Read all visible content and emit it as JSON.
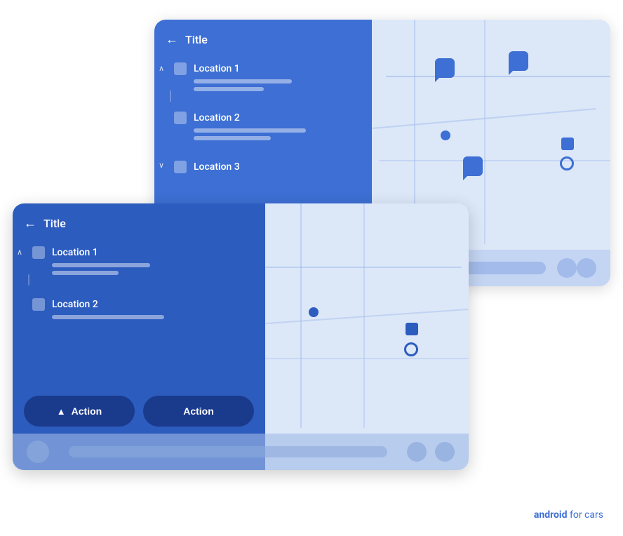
{
  "back_card": {
    "title": "Title",
    "back_arrow": "←",
    "locations": [
      {
        "name": "Location 1",
        "sub_lines": [
          140,
          100
        ],
        "expanded": true,
        "chevron": "∧"
      },
      {
        "name": "Location 2",
        "sub_lines": [
          160,
          110
        ],
        "expanded": false,
        "chevron": ""
      },
      {
        "name": "Location 3",
        "sub_lines": [],
        "expanded": false,
        "chevron": "∨"
      }
    ]
  },
  "front_card": {
    "title": "Title",
    "back_arrow": "←",
    "locations": [
      {
        "name": "Location 1",
        "sub_lines": [
          140,
          95
        ],
        "expanded": true,
        "chevron": "∧"
      },
      {
        "name": "Location 2",
        "sub_lines": [
          160
        ],
        "expanded": false,
        "chevron": ""
      }
    ],
    "actions": [
      {
        "label": "Action",
        "has_icon": true
      },
      {
        "label": "Action",
        "has_icon": false
      }
    ]
  },
  "watermark": {
    "bold": "android",
    "normal": " for cars"
  }
}
